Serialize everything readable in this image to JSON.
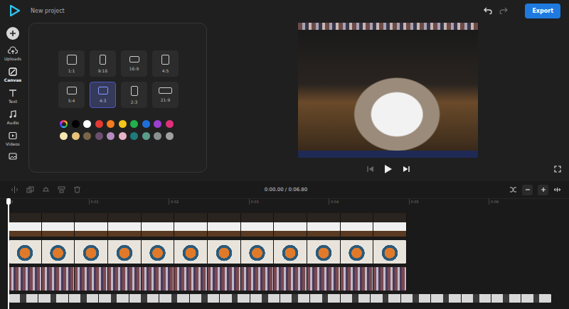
{
  "app": {
    "title": "New project",
    "export": "Export"
  },
  "rail": [
    {
      "label": "Uploads",
      "kind": "uploads",
      "selected": false
    },
    {
      "label": "Canvas",
      "kind": "canvas",
      "selected": true
    },
    {
      "label": "Text",
      "kind": "text",
      "selected": false
    },
    {
      "label": "Audio",
      "kind": "audio",
      "selected": false
    },
    {
      "label": "Videos",
      "kind": "videos",
      "selected": false
    }
  ],
  "canvas": {
    "ratios": [
      {
        "label": "1:1",
        "selected": false
      },
      {
        "label": "9:16",
        "selected": false
      },
      {
        "label": "16:9",
        "selected": false
      },
      {
        "label": "4:5",
        "selected": false
      },
      {
        "label": "5:4",
        "selected": false
      },
      {
        "label": "4:3",
        "selected": true
      },
      {
        "label": "2:3",
        "selected": false
      },
      {
        "label": "21:9",
        "selected": false
      }
    ],
    "swatches": [
      {
        "kind": "picker"
      },
      {
        "kind": "color",
        "color": "#000000"
      },
      {
        "kind": "color",
        "color": "#ffffff"
      },
      {
        "kind": "color",
        "color": "#e53935"
      },
      {
        "kind": "color",
        "color": "#f57c1f"
      },
      {
        "kind": "color",
        "color": "#f5c518"
      },
      {
        "kind": "color",
        "color": "#22b14c"
      },
      {
        "kind": "color",
        "color": "#1e6fd9"
      },
      {
        "kind": "color",
        "color": "#9b3fd1"
      },
      {
        "kind": "color",
        "color": "#e0307a"
      },
      {
        "kind": "color",
        "color": "#f5e6b3"
      },
      {
        "kind": "color",
        "color": "#e8c27a"
      },
      {
        "kind": "color",
        "color": "#7a6448"
      },
      {
        "kind": "color",
        "color": "#6a4f6e"
      },
      {
        "kind": "color",
        "color": "#b48cc0"
      },
      {
        "kind": "color",
        "color": "#e8b4c8"
      },
      {
        "kind": "color",
        "color": "#1f7a7a"
      },
      {
        "kind": "color",
        "color": "#5a9e8a"
      },
      {
        "kind": "color",
        "color": "#8a9090"
      },
      {
        "kind": "color",
        "color": "#a0a0a0"
      }
    ]
  },
  "timeline": {
    "time": "0:00.00 / 0:06.80",
    "ruler": [
      "0",
      "0:01",
      "0:02",
      "0:03",
      "0:04",
      "0:05",
      "0:06"
    ],
    "tracks": [
      {
        "frames": 12
      },
      {
        "frames": 12
      },
      {
        "frames": 12
      },
      {
        "frames": 18
      }
    ]
  }
}
